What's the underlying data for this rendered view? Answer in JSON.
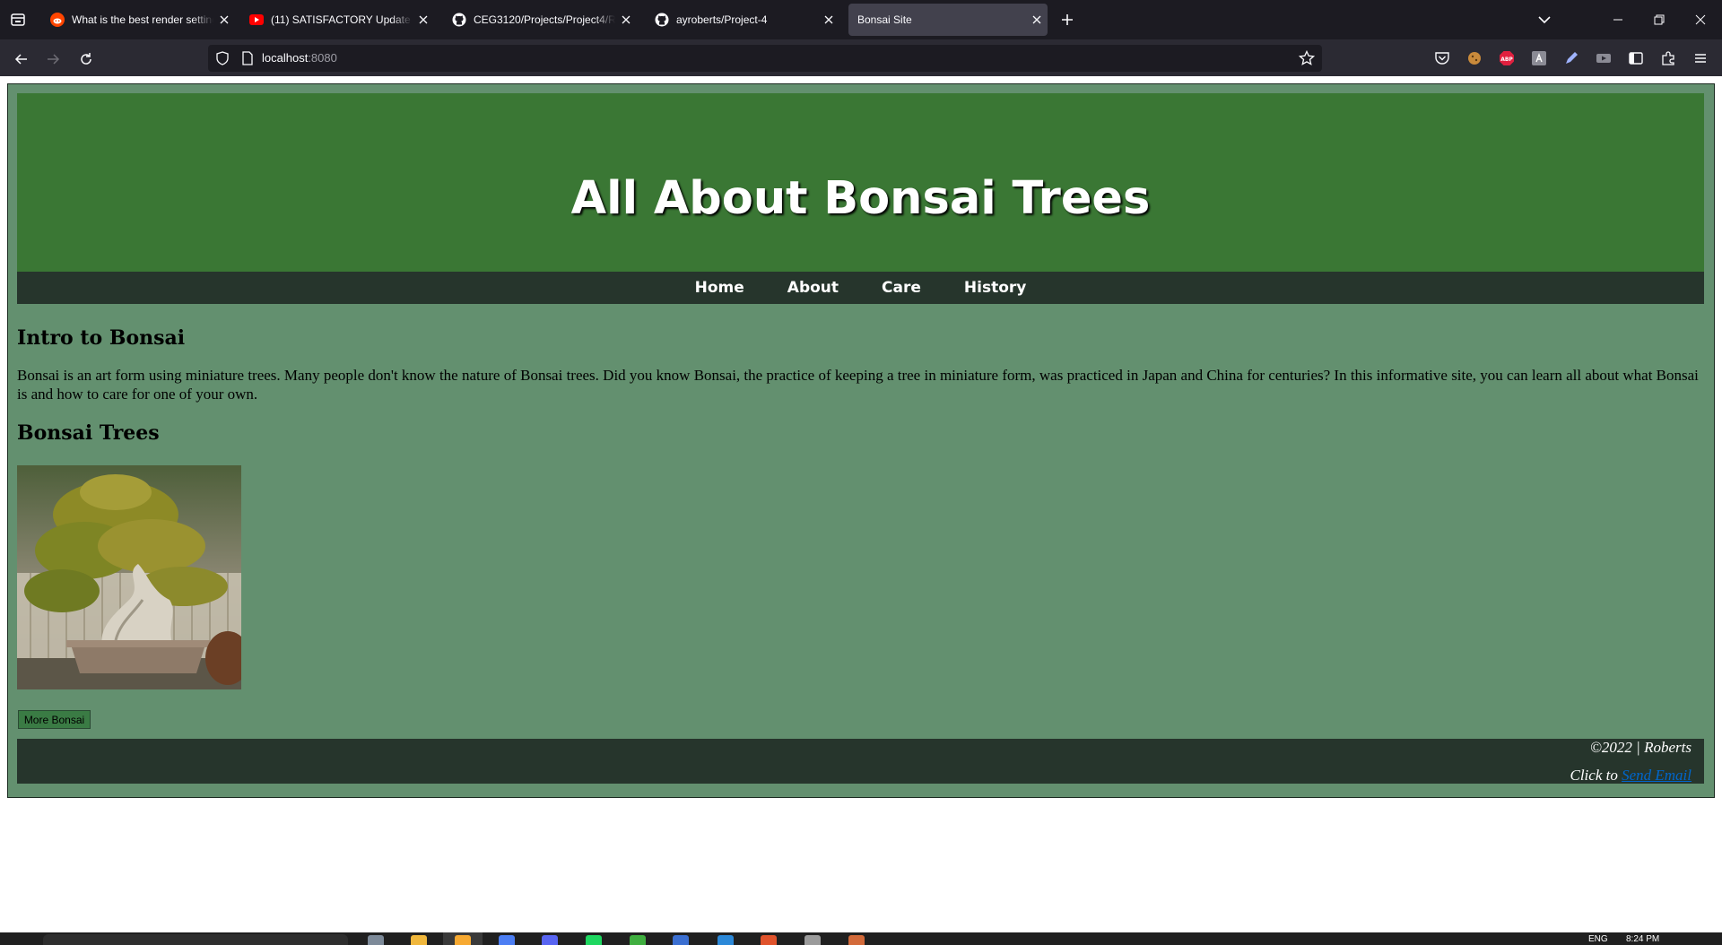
{
  "browser": {
    "tabs": [
      {
        "title": "What is the best render settings",
        "favicon": "reddit-icon"
      },
      {
        "title": "(11) SATISFACTORY Update 8 - S",
        "favicon": "youtube-icon"
      },
      {
        "title": "CEG3120/Projects/Project4/REA",
        "favicon": "github-icon"
      },
      {
        "title": "ayroberts/Project-4",
        "favicon": "github-icon"
      },
      {
        "title": "Bonsai Site",
        "favicon": "none",
        "active": true
      }
    ],
    "url": {
      "host": "localhost",
      "port": ":8080"
    }
  },
  "site": {
    "title": "All About Bonsai Trees",
    "nav": [
      "Home",
      "About",
      "Care",
      "History"
    ],
    "intro_heading": "Intro to Bonsai",
    "intro_text": "Bonsai is an art form using miniature trees. Many people don't know the nature of Bonsai trees. Did you know Bonsai, the practice of keeping a tree in miniature form, was practiced in Japan and China for centuries? In this informative site, you can learn all about what Bonsai is and how to care for one of your own.",
    "trees_heading": "Bonsai Trees",
    "more_button": "More Bonsai",
    "footer": {
      "copyright": "©2022 | Roberts",
      "click_to": "Click to",
      "email_link": "Send Email"
    }
  },
  "taskbar": {
    "lang": "ENG",
    "time": "8:24 PM"
  },
  "colors": {
    "page_bg": "#63906f",
    "header_bg": "#3a7734",
    "nav_bg": "#26352c",
    "button_bg": "#3a7b44",
    "link": "#0066cc"
  }
}
